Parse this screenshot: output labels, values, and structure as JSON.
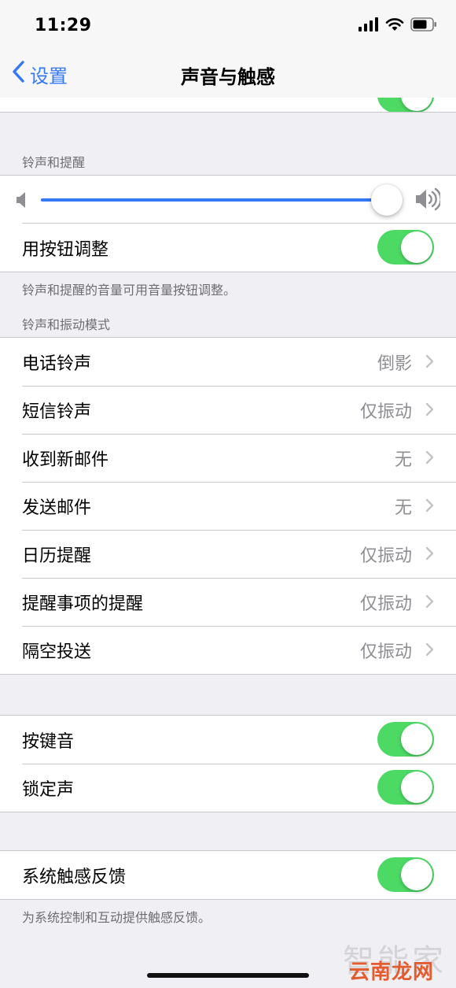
{
  "status_bar": {
    "time": "11:29",
    "icons": [
      "cellular-signal-icon",
      "wifi-icon",
      "battery-icon"
    ]
  },
  "nav": {
    "back_label": "设置",
    "title": "声音与触感"
  },
  "ringer_section": {
    "header": "铃声和提醒",
    "volume_level": 1.0,
    "change_with_buttons": {
      "label": "用按钮调整",
      "on": true
    },
    "footer": "铃声和提醒的音量可用音量按钮调整。"
  },
  "patterns_section": {
    "header": "铃声和振动模式",
    "items": [
      {
        "label": "电话铃声",
        "value": "倒影"
      },
      {
        "label": "短信铃声",
        "value": "仅振动"
      },
      {
        "label": "收到新邮件",
        "value": "无"
      },
      {
        "label": "发送邮件",
        "value": "无"
      },
      {
        "label": "日历提醒",
        "value": "仅振动"
      },
      {
        "label": "提醒事项的提醒",
        "value": "仅振动"
      },
      {
        "label": "隔空投送",
        "value": "仅振动"
      }
    ]
  },
  "clicks_section": {
    "items": [
      {
        "label": "按键音",
        "on": true
      },
      {
        "label": "锁定声",
        "on": true
      }
    ]
  },
  "haptics_section": {
    "item": {
      "label": "系统触感反馈",
      "on": true
    },
    "footer": "为系统控制和互动提供触感反馈。"
  },
  "watermark": {
    "text": "智能家",
    "brand": "云南龙网"
  },
  "colors": {
    "accent": "#3478f6",
    "toggle_on": "#4cd964",
    "background": "#efeff4",
    "secondary_text": "#8e8e93"
  }
}
